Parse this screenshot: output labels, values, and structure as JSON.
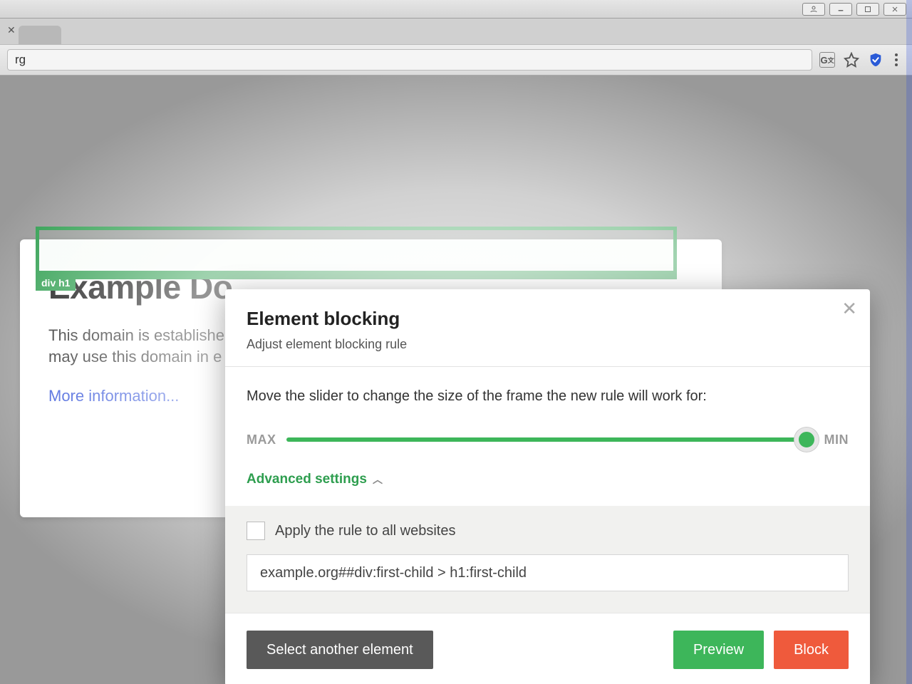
{
  "browser": {
    "url_fragment": "rg",
    "window_buttons": {
      "account": "account",
      "min": "minimize",
      "max": "maximize",
      "close": "close"
    }
  },
  "page": {
    "heading": "Example Do",
    "paragraph": "This domain is establishe\nmay use this domain in e",
    "link": "More information..."
  },
  "selection": {
    "tag": "div h1"
  },
  "modal": {
    "title": "Element blocking",
    "subtitle": "Adjust element blocking rule",
    "instruction": "Move the slider to change the size of the frame the new rule will work for:",
    "slider": {
      "left_label": "MAX",
      "right_label": "MIN"
    },
    "advanced_label": "Advanced settings",
    "apply_all_label": "Apply the rule to all websites",
    "rule_value": "example.org##div:first-child > h1:first-child",
    "buttons": {
      "select_another": "Select another element",
      "preview": "Preview",
      "block": "Block"
    }
  }
}
